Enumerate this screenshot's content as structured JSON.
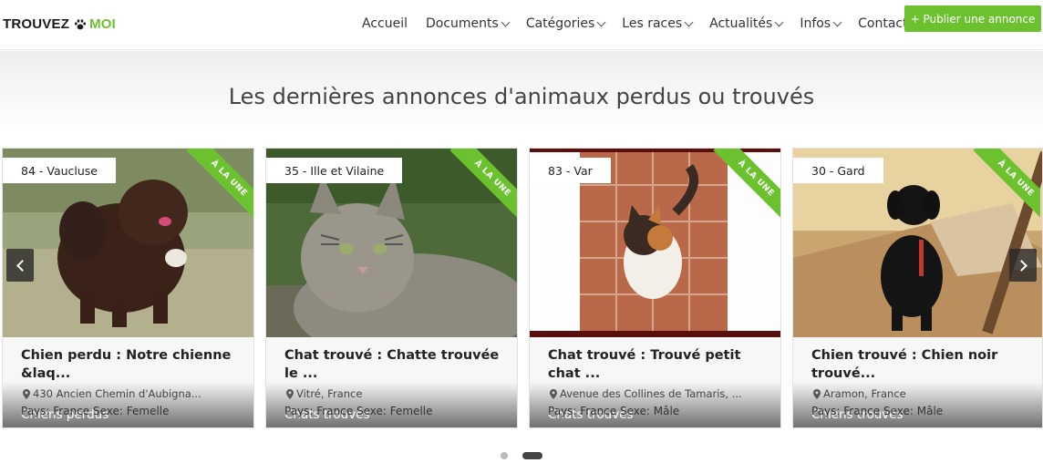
{
  "header": {
    "logo_part1": "TROUVEZ",
    "logo_part2": "MOI",
    "nav": [
      {
        "label": "Accueil",
        "dropdown": false
      },
      {
        "label": "Documents",
        "dropdown": true
      },
      {
        "label": "Catégories",
        "dropdown": true
      },
      {
        "label": "Les races",
        "dropdown": true
      },
      {
        "label": "Actualités",
        "dropdown": true
      },
      {
        "label": "Infos",
        "dropdown": true
      },
      {
        "label": "Contact",
        "dropdown": false
      }
    ],
    "publish_button": "+ Publier une annonce"
  },
  "section": {
    "title": "Les dernières annonces d'animaux perdus ou trouvés"
  },
  "cards": [
    {
      "department": "84 - Vaucluse",
      "ribbon": "À LA UNE",
      "category": "Chiens perdus",
      "title": "Chien perdu : Notre chienne &laq...",
      "location": "430 Ancien Chemin d'Aubigna...",
      "meta": "Pays: France Sexe: Femelle"
    },
    {
      "department": "35 - Ille et Vilaine",
      "ribbon": "À LA UNE",
      "category": "Chats trouvés",
      "title": "Chat trouvé : Chatte trouvée le ...",
      "location": "Vitré, France",
      "meta": "Pays: France Sexe: Femelle"
    },
    {
      "department": "83 - Var",
      "ribbon": "À LA UNE",
      "category": "Chats trouvés",
      "title": "Chat trouvé : Trouvé petit chat ...",
      "location": "Avenue des Collines de Tamaris, ...",
      "meta": "Pays: France Sexe: Mâle"
    },
    {
      "department": "30 - Gard",
      "ribbon": "À LA UNE",
      "category": "Chiens trouvés",
      "title": "Chien trouvé : Chien noir trouvé...",
      "location": "Aramon, France",
      "meta": "Pays: France Sexe: Mâle"
    }
  ],
  "carousel": {
    "prev_icon": "chevron-left-icon",
    "next_icon": "chevron-right-icon",
    "active_page": 2,
    "page_count": 2
  },
  "colors": {
    "accent": "#6cc12f",
    "text": "#333333"
  }
}
